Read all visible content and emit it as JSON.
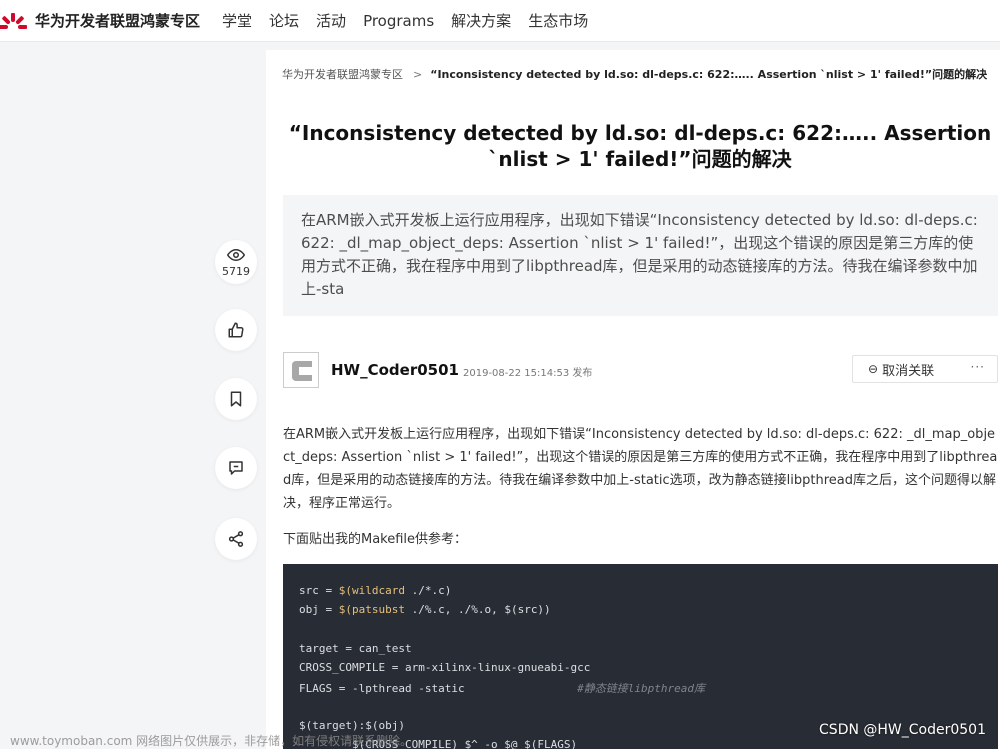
{
  "nav": {
    "brand": "华为开发者联盟鸿蒙专区",
    "items": [
      "学堂",
      "论坛",
      "活动",
      "Programs",
      "解决方案",
      "生态市场"
    ]
  },
  "rail": {
    "view_count": "5719",
    "icons": [
      "eye-icon",
      "thumbs-up-icon",
      "bookmark-icon",
      "comment-icon",
      "share-icon"
    ]
  },
  "breadcrumb": {
    "root": "华为开发者联盟鸿蒙专区",
    "separator": ">",
    "current": "“Inconsistency detected by ld.so: dl-deps.c: 622:….. Assertion `nlist > 1' failed!”问题的解决"
  },
  "article": {
    "title": "“Inconsistency detected by ld.so: dl-deps.c: 622:….. Assertion `nlist > 1' failed!”问题的解决",
    "summary": "在ARM嵌入式开发板上运行应用程序，出现如下错误“Inconsistency detected by ld.so: dl-deps.c: 622: _dl_map_object_deps: Assertion `nlist > 1' failed!”，出现这个错误的原因是第三方库的使用方式不正确，我在程序中用到了libpthread库，但是采用的动态链接库的方法。待我在编译参数中加上-sta",
    "author": "HW_Coder0501",
    "dot": "·",
    "date": "2019-08-22 15:14:53 发布",
    "follow_label": "取消关联",
    "more_label": "···",
    "paragraph1": "在ARM嵌入式开发板上运行应用程序，出现如下错误“Inconsistency detected by ld.so: dl-deps.c: 622: _dl_map_object_deps: Assertion `nlist > 1' failed!”，出现这个错误的原因是第三方库的使用方式不正确，我在程序中用到了libpthread库，但是采用的动态链接库的方法。待我在编译参数中加上-static选项，改为静态链接libpthread库之后，这个问题得以解决，程序正常运行。",
    "paragraph2": "下面贴出我的Makefile供参考："
  },
  "code": {
    "lines": [
      {
        "a": "src = ",
        "fn": "$(wildcard",
        "b": " ./*.c)",
        "cm": ""
      },
      {
        "a": "obj = ",
        "fn": "$(patsubst",
        "b": " ./%.c, ./%.o, $(src))",
        "cm": ""
      },
      {
        "a": "",
        "fn": "",
        "b": "",
        "cm": ""
      },
      {
        "a": "target = can_test",
        "fn": "",
        "b": "",
        "cm": ""
      },
      {
        "a": "CROSS_COMPILE = arm-xilinx-linux-gnueabi-gcc",
        "fn": "",
        "b": "",
        "cm": ""
      },
      {
        "a": "FLAGS = -lpthread -static",
        "fn": "",
        "b": "                 ",
        "cm": "#静态链接libpthread库"
      },
      {
        "a": "",
        "fn": "",
        "b": "",
        "cm": ""
      },
      {
        "a": "$(target):$(obj)",
        "fn": "",
        "b": "",
        "cm": ""
      },
      {
        "a": "        $(CROSS_COMPILE) $^ -o $@ $(FLAGS)",
        "fn": "",
        "b": "",
        "cm": ""
      }
    ]
  },
  "watermarks": {
    "left": "www.toymoban.com 网络图片仅供展示，非存储，如有侵权请联系删除。",
    "right": "CSDN @HW_Coder0501"
  }
}
